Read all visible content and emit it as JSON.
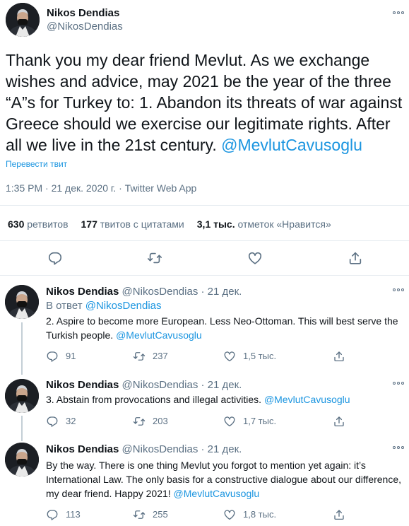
{
  "main": {
    "author_name": "Nikos Dendias",
    "author_handle": "@NikosDendias",
    "text": "Thank you my dear friend Mevlut. As we exchange wishes and advice, may 2021 be the year of the three “A”s for Turkey to: 1. Abandon its threats of war against Greece should we exercise our legitimate rights. After all we live in the 21st century.",
    "mention": "@MevlutCavusoglu",
    "translate_label": "Перевести твит",
    "meta": "1:35 PM · 21 дек. 2020 г. · Twitter Web App",
    "stats": {
      "retweets_count": "630",
      "retweets_label": "ретвитов",
      "quotes_count": "177",
      "quotes_label": "твитов с цитатами",
      "likes_count": "3,1 тыс.",
      "likes_label": "отметок «Нравится»"
    }
  },
  "replies": [
    {
      "author_name": "Nikos Dendias",
      "handle_date": "@NikosDendias · 21 дек.",
      "in_reply_label": "В ответ",
      "in_reply_handle": "@NikosDendias",
      "text": "2. Aspire to become more European. Less Neo-Ottoman. This will best serve the Turkish people.",
      "mention": "@MevlutCavusoglu",
      "replies": "91",
      "retweets": "237",
      "likes": "1,5 тыс."
    },
    {
      "author_name": "Nikos Dendias",
      "handle_date": "@NikosDendias · 21 дек.",
      "text": "3. Abstain from provocations and illegal activities.",
      "mention": "@MevlutCavusoglu",
      "replies": "32",
      "retweets": "203",
      "likes": "1,7 тыс."
    },
    {
      "author_name": "Nikos Dendias",
      "handle_date": "@NikosDendias · 21 дек.",
      "text": "By the way. There is one thing Mevlut you forgot to mention yet again: it’s International Law. The only basis for a constructive dialogue about our difference, my dear friend. Happy 2021!",
      "mention": "@MevlutCavusoglu",
      "replies": "113",
      "retweets": "255",
      "likes": "1,8 тыс."
    }
  ],
  "colors": {
    "link": "#1b95e0",
    "muted": "#5b7083",
    "text": "#0f1419",
    "divider": "#e6ecf0"
  },
  "icons": [
    "more-icon",
    "reply-icon",
    "retweet-icon",
    "like-icon",
    "share-icon",
    "avatar"
  ]
}
